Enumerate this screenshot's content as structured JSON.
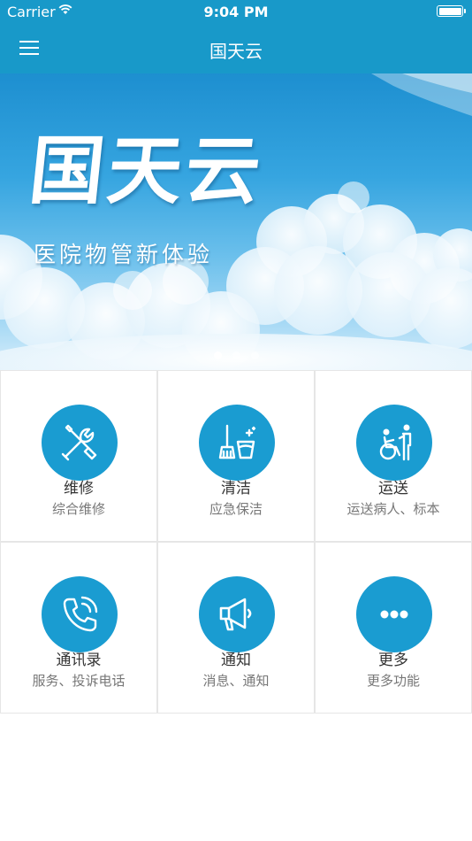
{
  "status_bar": {
    "carrier": "Carrier",
    "time": "9:04 PM"
  },
  "nav": {
    "title": "国天云",
    "menu_icon": "hamburger-menu-icon"
  },
  "banner": {
    "brand": "国天云",
    "slogan": "医院物管新体验",
    "page_count": 3,
    "active_page": 1
  },
  "tiles": [
    {
      "title": "维修",
      "subtitle": "综合维修",
      "icon": "tools-icon"
    },
    {
      "title": "清洁",
      "subtitle": "应急保洁",
      "icon": "cleaning-icon"
    },
    {
      "title": "运送",
      "subtitle": "运送病人、标本",
      "icon": "wheelchair-icon"
    },
    {
      "title": "通讯录",
      "subtitle": "服务、投诉电话",
      "icon": "phone-icon"
    },
    {
      "title": "通知",
      "subtitle": "消息、通知",
      "icon": "megaphone-icon"
    },
    {
      "title": "更多",
      "subtitle": "更多功能",
      "icon": "more-icon"
    }
  ],
  "colors": {
    "primary": "#1899c9",
    "icon_bg": "#1a9cd1",
    "divider": "#e6e6e6"
  }
}
